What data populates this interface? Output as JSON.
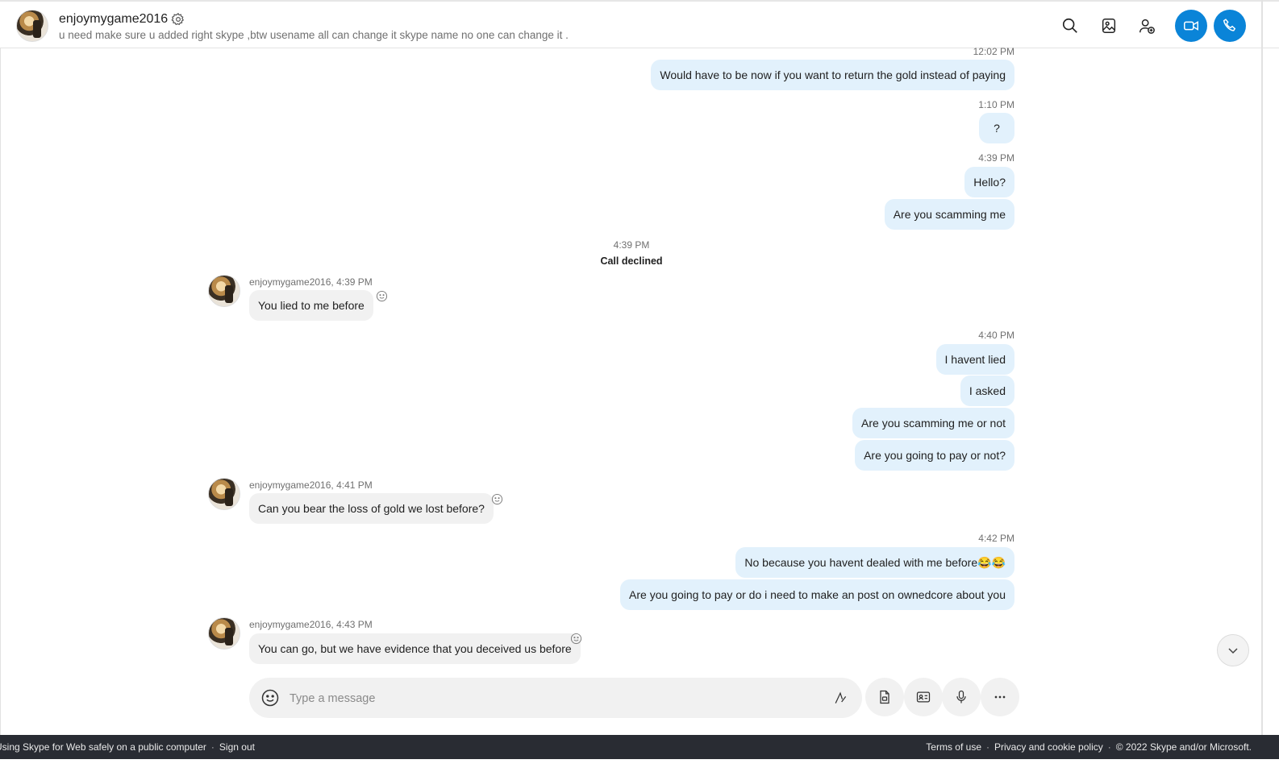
{
  "header": {
    "name": "enjoymygame2016",
    "mood": "u need make sure u added right skype ,btw usename all can change it skype name no one can change it ."
  },
  "messages": {
    "m1_time": "12:02 PM",
    "m1_text": "Would have to be now if you want to return the gold instead of paying",
    "m2_time": "1:10 PM",
    "m2_text": "?",
    "m3_time": "4:39 PM",
    "m3_text": "Hello?",
    "m4_text": "Are you scamming me",
    "call_time": "4:39 PM",
    "call_text": "Call declined",
    "in1_sender": "enjoymygame2016, 4:39 PM",
    "in1_text": "You lied to me before",
    "m5_time": "4:40 PM",
    "m5_text": "I havent lied",
    "m6_text": "I asked",
    "m7_text": "Are you scamming me or not",
    "m8_text": "Are you going to pay or not?",
    "in2_sender": "enjoymygame2016, 4:41 PM",
    "in2_text": "Can you bear the loss of gold  we lost before?",
    "m9_time": "4:42 PM",
    "m9_text": "No because you havent dealed with me before😂😂",
    "m10_text": "Are you going to pay or do i need to make an post on ownedcore about you",
    "in3_sender": "enjoymygame2016, 4:43 PM",
    "in3_text": "You can go, but we have evidence that you deceived us before"
  },
  "composer": {
    "placeholder": "Type a message"
  },
  "footer": {
    "left_text": "Using Skype for Web safely on a public computer",
    "sign_out": "Sign out",
    "terms": "Terms of use",
    "privacy": "Privacy and cookie policy",
    "copyright": "© 2022 Skype and/or Microsoft."
  },
  "colors": {
    "accent": "#0a84d8",
    "outgoing_bubble": "#e2f1fc",
    "incoming_bubble": "#f1f1f1",
    "footer_bg": "#292c33"
  }
}
